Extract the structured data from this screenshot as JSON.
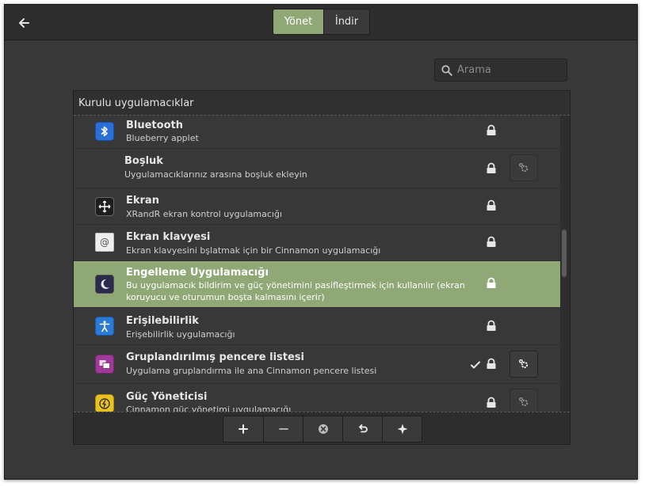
{
  "header": {
    "back_icon": "back-arrow-icon",
    "tabs": [
      {
        "label": "Yönet",
        "active": true
      },
      {
        "label": "İndir",
        "active": false
      }
    ]
  },
  "search": {
    "placeholder": "Arama",
    "icon": "search-icon"
  },
  "panel": {
    "title": "Kurulu uygulamacıklar",
    "applets": [
      {
        "name": "Bluetooth",
        "desc": "Blueberry applet",
        "icon": "bluetooth-icon",
        "locked": true,
        "configurable": false,
        "enabled": false,
        "selected": false
      },
      {
        "name": "Boşluk",
        "desc": "Uygulamacıklarınız arasına boşluk ekleyin",
        "icon": "",
        "locked": true,
        "configurable": true,
        "enabled": false,
        "selected": false
      },
      {
        "name": "Ekran",
        "desc": "XRandR ekran kontrol uygulamacığı",
        "icon": "display-icon",
        "locked": true,
        "configurable": false,
        "enabled": false,
        "selected": false
      },
      {
        "name": "Ekran klavyesi",
        "desc": "Ekran klavyesini bşlatmak için bir Cinnamon uygulamacığı",
        "icon": "keyboard-icon",
        "locked": true,
        "configurable": false,
        "enabled": false,
        "selected": false
      },
      {
        "name": "Engelleme Uygulamacığı",
        "desc": "Bu uygulamacık bildirim ve güç yönetimini pasifleştirmek için kullanılır (ekran koruyucu ve oturumun boşta kalmasını içerir)",
        "icon": "moon-icon",
        "locked": true,
        "configurable": false,
        "enabled": false,
        "selected": true
      },
      {
        "name": "Erişilebilirlik",
        "desc": "Erişebilirlik uygulamacığı",
        "icon": "accessibility-icon",
        "locked": true,
        "configurable": false,
        "enabled": false,
        "selected": false
      },
      {
        "name": "Gruplandırılmış pencere listesi",
        "desc": "Uygulama gruplandırma ile ana Cinnamon pencere listesi",
        "icon": "window-list-icon",
        "locked": true,
        "configurable": true,
        "enabled": true,
        "selected": false
      },
      {
        "name": "Güç Yöneticisi",
        "desc": "Cinnamon güç yönetimi uygulamacığı",
        "icon": "power-icon",
        "locked": true,
        "configurable": true,
        "enabled": false,
        "selected": false
      }
    ]
  },
  "toolbar": {
    "buttons": [
      "add-icon",
      "remove-icon",
      "uninstall-icon",
      "restore-icon",
      "more-icon"
    ]
  },
  "colors": {
    "accent": "#8fa876",
    "bg": "#383838",
    "header": "#2d2d2d"
  }
}
